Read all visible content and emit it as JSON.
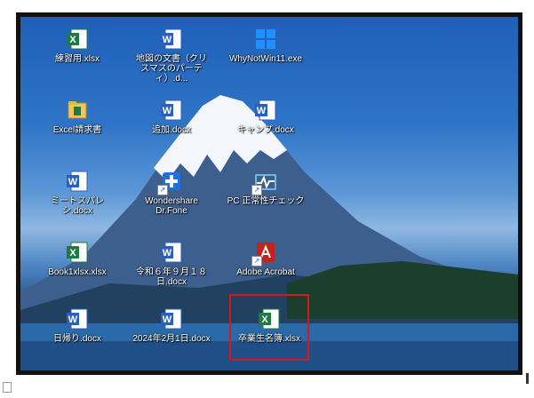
{
  "desktop": {
    "icons": [
      {
        "id": "excel-practice",
        "label": "練習用.xlsx",
        "type": "excel",
        "shortcut": false
      },
      {
        "id": "word-map",
        "label": "地図の文書（クリスマスのパーティ）.d...",
        "type": "word",
        "shortcut": false
      },
      {
        "id": "whynot",
        "label": "WhyNotWin11.exe",
        "type": "app",
        "shortcut": false
      },
      {
        "id": "excel-invoice",
        "label": "Excel請求書",
        "type": "folder",
        "shortcut": false
      },
      {
        "id": "word-add",
        "label": "追加.docx",
        "type": "word",
        "shortcut": false
      },
      {
        "id": "word-camp",
        "label": "キャンプ.docx",
        "type": "word",
        "shortcut": false
      },
      {
        "id": "word-meet",
        "label": "ミートスパレシ.docx",
        "type": "word",
        "shortcut": false
      },
      {
        "id": "wondershare",
        "label": "Wondershare Dr.Fone",
        "type": "app-plus",
        "shortcut": true
      },
      {
        "id": "pc-check",
        "label": "PC 正常性チェック",
        "type": "app-wave",
        "shortcut": true
      },
      {
        "id": "excel-book1",
        "label": "Book1xlsx.xlsx",
        "type": "excel",
        "shortcut": false
      },
      {
        "id": "word-reiwa",
        "label": "令和６年９月１８日.docx",
        "type": "word",
        "shortcut": false
      },
      {
        "id": "acrobat",
        "label": "Adobe Acrobat",
        "type": "pdf",
        "shortcut": true
      },
      {
        "id": "word-daytrip",
        "label": "日帰り.docx",
        "type": "word",
        "shortcut": false
      },
      {
        "id": "word-2024",
        "label": "2024年2月1日.docx",
        "type": "word",
        "shortcut": false
      },
      {
        "id": "excel-graduates",
        "label": "卒業生名簿.xlsx",
        "type": "excel",
        "shortcut": false
      }
    ]
  },
  "colors": {
    "excel": "#1d7a43",
    "word": "#2b5fc1",
    "selection": "#d81818",
    "pdf": "#c8201a",
    "app": "#1e90ff"
  }
}
